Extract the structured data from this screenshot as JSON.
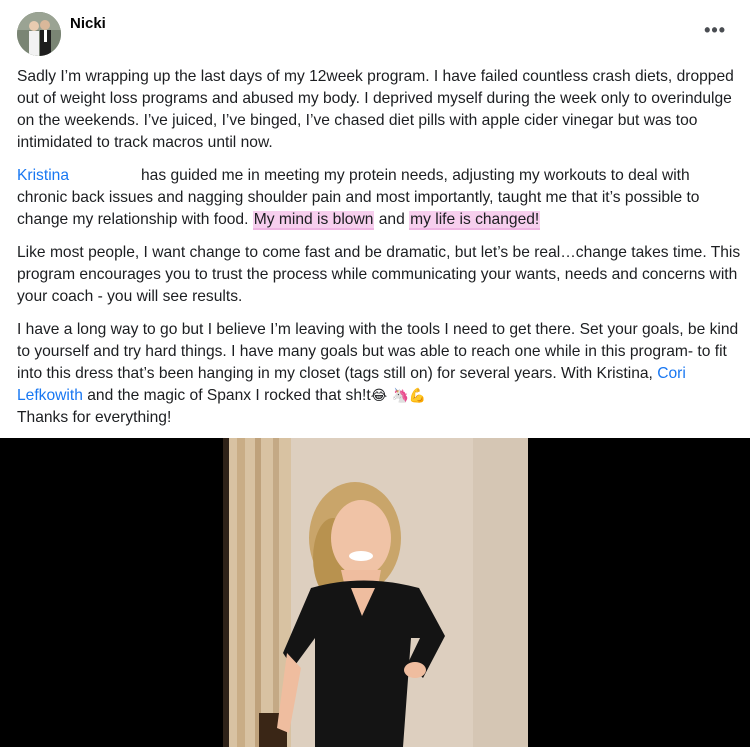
{
  "post": {
    "author": "Nicki",
    "more_icon": "•••",
    "paragraphs": {
      "p1": "Sadly I’m wrapping up the last days of my 12week program. I have failed countless crash diets, dropped out of weight loss programs and abused my body. I deprived myself during the week only to overindulge on the weekends. I’ve juiced, I’ve binged, I’ve chased diet pills with apple cider vinegar but was too intimidated to track macros until now.",
      "p2_mention": "Kristina",
      "p2_text": "has guided me in meeting my protein needs, adjusting my workouts to deal with chronic back issues and nagging shoulder pain and most importantly, taught me that it’s possible to change my relationship with food.",
      "p2_highlight1": "My mind is blown",
      "p2_and": "and",
      "p2_highlight2": "my life is changed!",
      "p3": "Like most people, I want change to come fast and be dramatic, but let’s be real…change takes time. This program encourages you to trust the process while communicating your wants, needs and concerns with your coach - you will see results.",
      "p4_text1": "I have a long way to go but I believe I’m leaving with the tools I need to get there. Set your goals, be kind to yourself and try hard things. I have many goals but was able to reach one while in this program- to fit into this dress that’s been hanging in my closet (tags still on) for several years. With Kristina,",
      "p4_mention": "Cori Lefkowith",
      "p4_text2": "and the magic of Spanx I rocked that sh!t",
      "p4_emojis": "😂 🦄💪",
      "p5": "Thanks for everything!"
    }
  },
  "colors": {
    "link": "#1877f2",
    "highlight": "#f7cfee",
    "photo_background": "#000000"
  }
}
